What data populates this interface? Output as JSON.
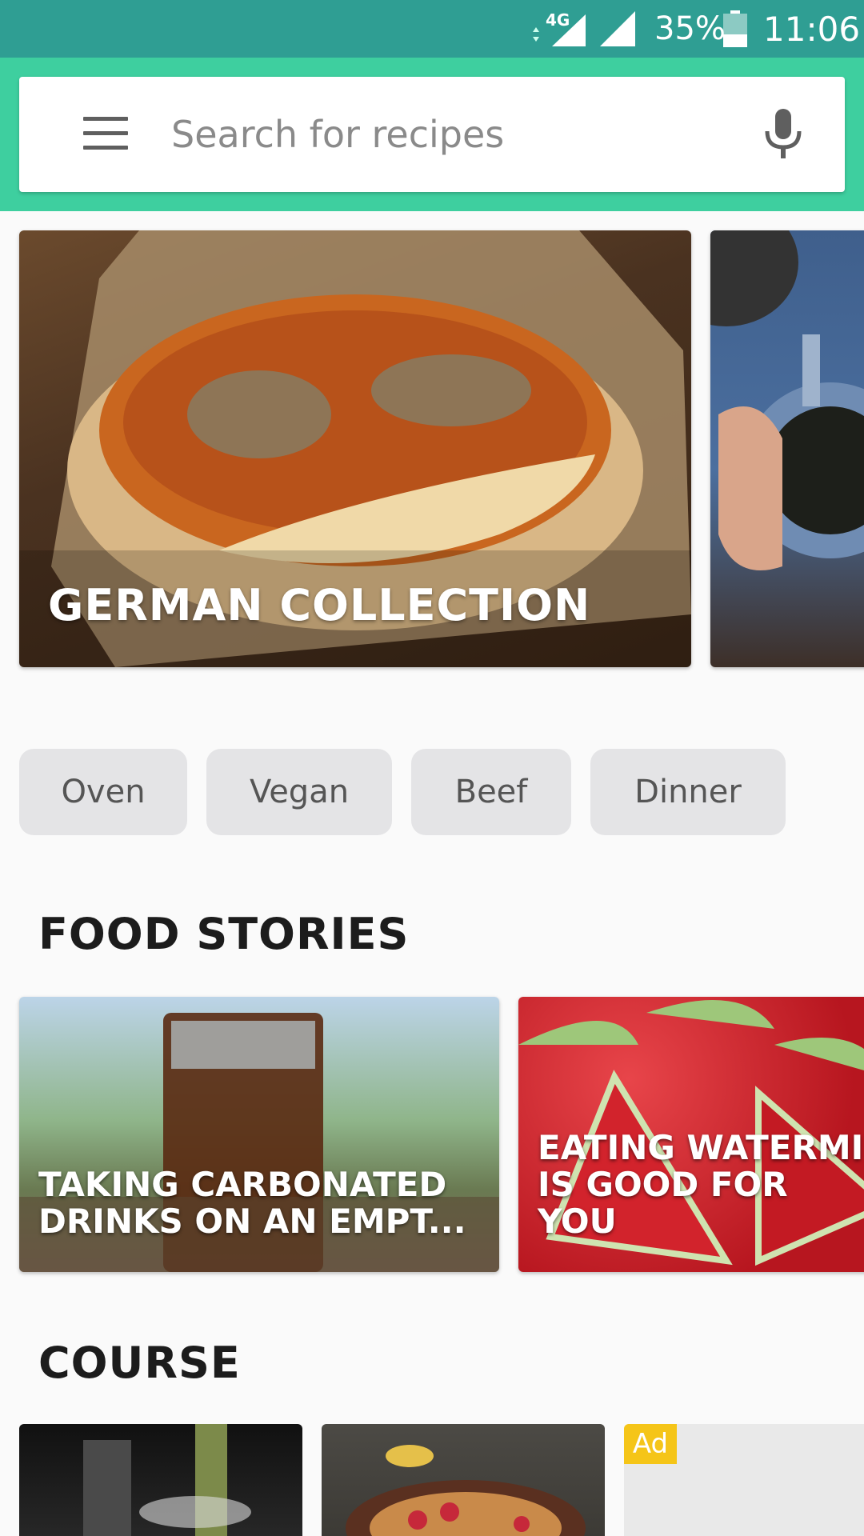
{
  "status_bar": {
    "network": "4G",
    "battery": "35%",
    "time": "11:06"
  },
  "search": {
    "placeholder": "Search for recipes"
  },
  "hero": {
    "cards": [
      {
        "title": "GERMAN COLLECTION"
      },
      {
        "title": ""
      }
    ]
  },
  "chips": [
    "Oven",
    "Vegan",
    "Beef",
    "Dinner"
  ],
  "food_stories": {
    "title": "FOOD STORIES",
    "cards": [
      {
        "title": "TAKING CARBONATED\nDRINKS ON AN EMPT..."
      },
      {
        "title": "EATING WATERMI\nIS GOOD FOR YOU"
      }
    ]
  },
  "course": {
    "title": "COURSE",
    "ad_label": "Ad"
  },
  "colors": {
    "status_bar": "#2f9e93",
    "app_bar": "#3ecf9f",
    "chip_bg": "#e4e4e6",
    "ad_badge": "#f5c518"
  }
}
